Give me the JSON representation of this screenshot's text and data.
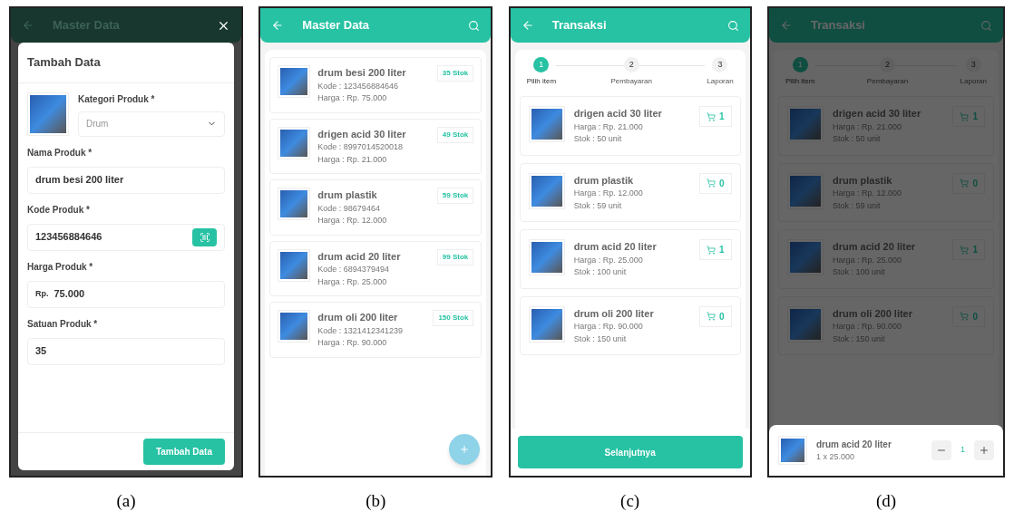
{
  "form_screen": {
    "caption": "(a)",
    "header_title": "Master Data",
    "dialog": {
      "title": "Tambah Data",
      "category": {
        "label": "Kategori Produk *",
        "value": "Drum"
      },
      "fields": [
        {
          "kind": "text",
          "label": "Nama Produk *",
          "value": "drum besi 200 liter"
        },
        {
          "kind": "scan",
          "label": "Kode Produk *",
          "value": "123456884646"
        },
        {
          "kind": "price",
          "label": "Harga Produk *",
          "prefix": "Rp.",
          "value": "75.000"
        },
        {
          "kind": "text",
          "label": "Satuan Produk *",
          "value": "35"
        }
      ],
      "submit": "Tambah Data"
    }
  },
  "list_screen": {
    "caption": "(b)",
    "title": "Master Data",
    "products": [
      {
        "name": "drum besi 200 liter",
        "code": "Kode : 123456884646",
        "price": "Harga : Rp. 75.000",
        "stock": "35 Stok"
      },
      {
        "name": "drigen acid 30 liter",
        "code": "Kode : 8997014520018",
        "price": "Harga : Rp. 21.000",
        "stock": "49 Stok"
      },
      {
        "name": "drum plastik",
        "code": "Kode : 98679464",
        "price": "Harga : Rp. 12.000",
        "stock": "59 Stok"
      },
      {
        "name": "drum acid 20 liter",
        "code": "Kode : 6894379494",
        "price": "Harga : Rp. 25.000",
        "stock": "99 Stok"
      },
      {
        "name": "drum oli 200 liter",
        "code": "Kode : 1321412341239",
        "price": "Harga : Rp. 90.000",
        "stock": "150 Stok"
      }
    ]
  },
  "transaction_screen": {
    "caption": "(c)",
    "title": "Transaksi",
    "steps": [
      {
        "number": "1",
        "label": "Pilih item",
        "selected": true
      },
      {
        "number": "2",
        "label": "Pembayaran",
        "selected": false
      },
      {
        "number": "3",
        "label": "Laporan",
        "selected": false
      }
    ],
    "items": [
      {
        "name": "drigen acid 30 liter",
        "price": "Harga : Rp. 21.000",
        "stock": "Stok : 50 unit",
        "count": "1"
      },
      {
        "name": "drum plastik",
        "price": "Harga : Rp. 12.000",
        "stock": "Stok : 59 unit",
        "count": "0"
      },
      {
        "name": "drum acid 20 liter",
        "price": "Harga : Rp. 25.000",
        "stock": "Stok : 100 unit",
        "count": "1"
      },
      {
        "name": "drum oli 200 liter",
        "price": "Harga : Rp. 90.000",
        "stock": "Stok : 150 unit",
        "count": "0"
      }
    ],
    "next_button": "Selanjutnya"
  },
  "cart_screen": {
    "caption": "(d)",
    "title": "Transaksi",
    "steps": [
      {
        "number": "1",
        "label": "Pilih item",
        "selected": true
      },
      {
        "number": "2",
        "label": "Pembayaran",
        "selected": false
      },
      {
        "number": "3",
        "label": "Laporan",
        "selected": false
      }
    ],
    "items": [
      {
        "name": "drigen acid 30 liter",
        "price": "Harga : Rp. 21.000",
        "stock": "Stok : 50 unit",
        "count": "1"
      },
      {
        "name": "drum plastik",
        "price": "Harga : Rp. 12.000",
        "stock": "Stok : 59 unit",
        "count": "0"
      },
      {
        "name": "drum acid 20 liter",
        "price": "Harga : Rp. 25.000",
        "stock": "Stok : 100 unit",
        "count": "1"
      },
      {
        "name": "drum oli 200 liter",
        "price": "Harga : Rp. 90.000",
        "stock": "Stok : 150 unit",
        "count": "0"
      }
    ],
    "sheet": {
      "name": "drum acid 20 liter",
      "line": "1 x 25.000",
      "quantity": "1"
    }
  }
}
